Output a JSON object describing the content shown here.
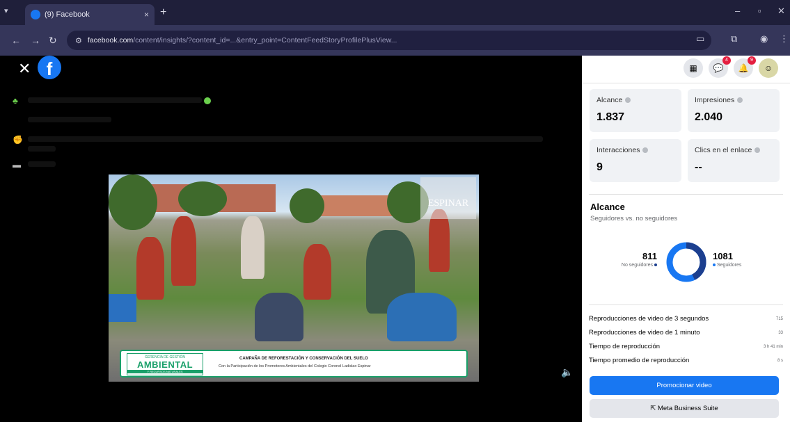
{
  "browser": {
    "tab_title": "(9) Facebook",
    "tab_close": "×",
    "new_tab": "+",
    "tab_list": "▾",
    "window_controls": {
      "minimize": "–",
      "maximize": "▫",
      "close": "✕"
    },
    "nav": {
      "back": "←",
      "forward": "→",
      "reload": "↻"
    },
    "url_host": "facebook.com",
    "url_path": "/content/insights/?content_id=...&entry_point=ContentFeedStoryProfilePlusView..."
  },
  "viewer": {
    "close_icon": "✕",
    "fb_logo": "f",
    "speaker_icon": "🔈",
    "video": {
      "watermark": "ESPINAR",
      "banner_badge_top": "GERENCIA DE GESTIÓN",
      "banner_badge_main": "AMBIENTAL",
      "banner_badge_bottom": "Y RECURSOS NATURALES",
      "banner_title": "CAMPAÑA DE REFORESTACIÓN Y CONSERVACIÓN DEL SUELO",
      "banner_subtitle": "Con la Participación de los Promotores Ambientales del Colegio Coronel Ladislao Espinar"
    }
  },
  "panel": {
    "notifications": {
      "messenger_count": "4",
      "alerts_count": "9"
    },
    "stats": [
      {
        "label": "Alcance",
        "value": "1.837"
      },
      {
        "label": "Impresiones",
        "value": "2.040"
      },
      {
        "label": "Interacciones",
        "value": "9"
      },
      {
        "label": "Clics en el enlace",
        "value": "--"
      }
    ],
    "reach": {
      "title": "Alcance",
      "subtitle": "Seguidores vs. no seguidores",
      "non_followers_value": "811",
      "non_followers_label": "No seguidores",
      "followers_value": "1081",
      "followers_label": "Seguidores",
      "colors": {
        "followers": "#1877f2",
        "non_followers": "#1c3f8f"
      }
    },
    "metrics": [
      {
        "label": "Reproducciones de video de 3 segundos",
        "value": "715"
      },
      {
        "label": "Reproducciones de video de 1 minuto",
        "value": "33"
      },
      {
        "label": "Tiempo de reproducción",
        "value": "3 h 41 min"
      },
      {
        "label": "Tiempo promedio de reproducción",
        "value": "8 s"
      }
    ],
    "promote_button": "Promocionar video",
    "meta_button": "Meta Business Suite"
  }
}
